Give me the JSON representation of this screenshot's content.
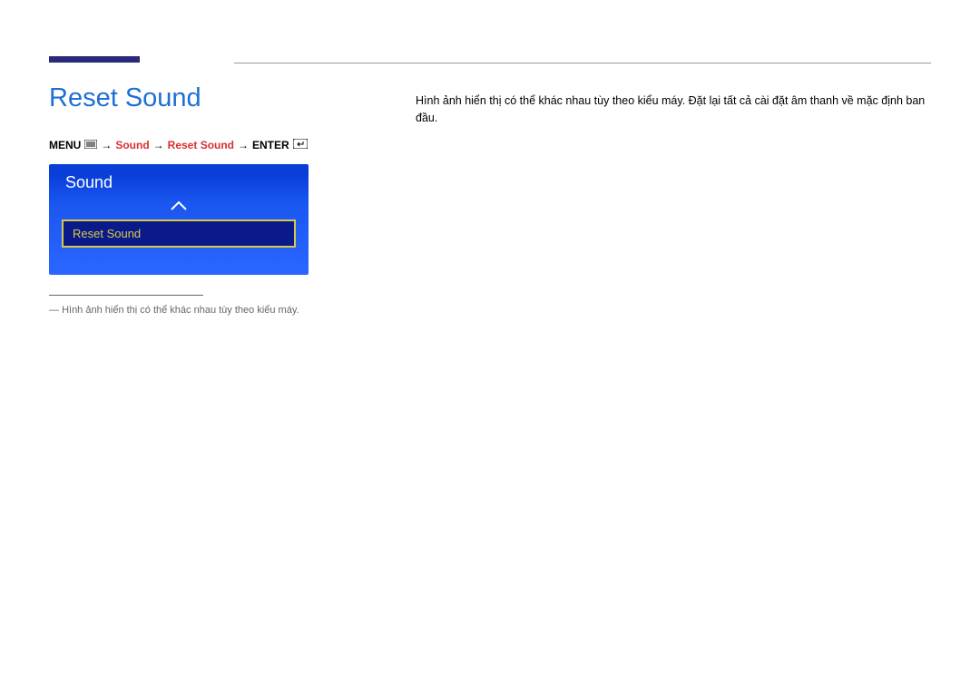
{
  "page": {
    "title": "Reset Sound"
  },
  "breadcrumb": {
    "menu": "MENU",
    "sound": "Sound",
    "reset_sound": "Reset Sound",
    "enter": "ENTER",
    "arrow": "→"
  },
  "osd": {
    "header": "Sound",
    "selected_item": "Reset Sound"
  },
  "footnote": {
    "dash": "―",
    "text": "Hình ảnh hiển thị có thể khác nhau tùy theo kiểu máy."
  },
  "body": {
    "text": "Hình ảnh hiển thị có thể khác nhau tùy theo kiểu máy. Đặt lại tất cả cài đặt âm thanh về mặc định ban đầu."
  }
}
